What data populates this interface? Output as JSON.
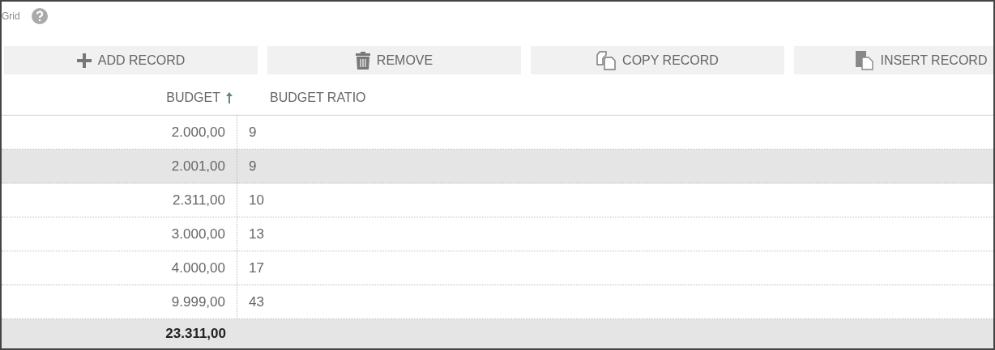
{
  "title": "Grid",
  "toolbar": [
    {
      "kind": "add",
      "label": "ADD RECORD"
    },
    {
      "kind": "remove",
      "label": "REMOVE"
    },
    {
      "kind": "copy",
      "label": "COPY RECORD"
    },
    {
      "kind": "insert",
      "label": "INSERT RECORD"
    }
  ],
  "columns": [
    {
      "label": "BUDGET",
      "sorted": true
    },
    {
      "label": "BUDGET RATIO",
      "sorted": false
    }
  ],
  "rows": [
    {
      "budget": "2.000,00",
      "ratio": "9",
      "selected": false
    },
    {
      "budget": "2.001,00",
      "ratio": "9",
      "selected": true
    },
    {
      "budget": "2.311,00",
      "ratio": "10",
      "selected": false
    },
    {
      "budget": "3.000,00",
      "ratio": "13",
      "selected": false
    },
    {
      "budget": "4.000,00",
      "ratio": "17",
      "selected": false
    },
    {
      "budget": "9.999,00",
      "ratio": "43",
      "selected": false
    }
  ],
  "total": {
    "budget": "23.311,00"
  }
}
